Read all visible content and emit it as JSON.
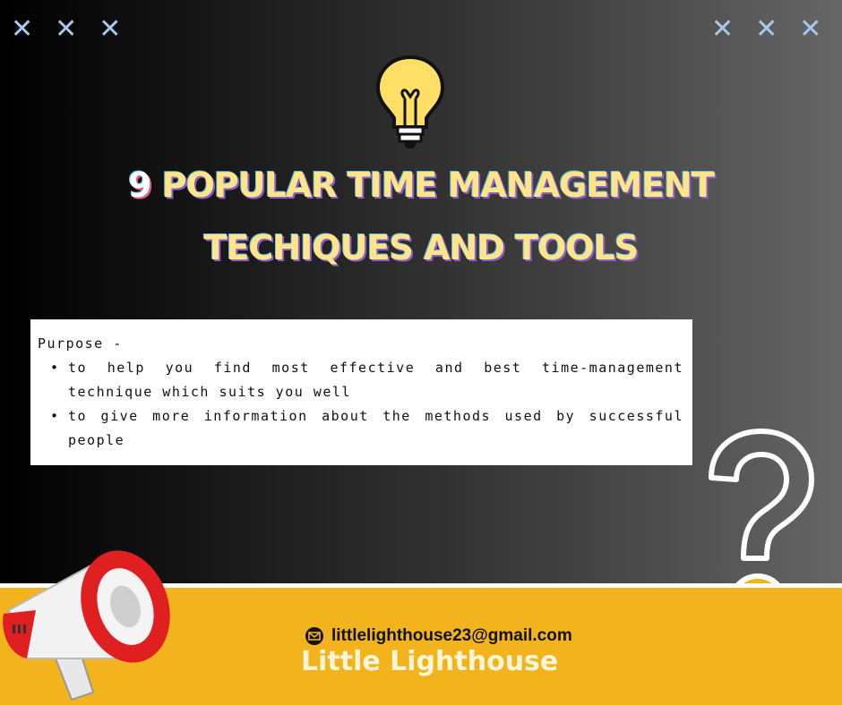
{
  "decor": {
    "x_marks_left": [
      "✕",
      "✕",
      "✕"
    ],
    "x_marks_right": [
      "✕",
      "✕",
      "✕"
    ]
  },
  "title": {
    "number": "9",
    "line1": "POPULAR TIME MANAGEMENT",
    "line2": "TECHIQUES AND TOOLS"
  },
  "purpose": {
    "heading": "Purpose -",
    "bullets": [
      "to help you find most effective and best time-management technique which suits you well",
      "to give more information about the methods used by successful people"
    ]
  },
  "footer": {
    "email": "littlelighthouse23@gmail.com",
    "brand": "Little Lighthouse"
  },
  "colors": {
    "title": "#ffe58a",
    "band": "#f2b31c",
    "bulb": "#ffe066",
    "megaphone": "#e02020"
  }
}
